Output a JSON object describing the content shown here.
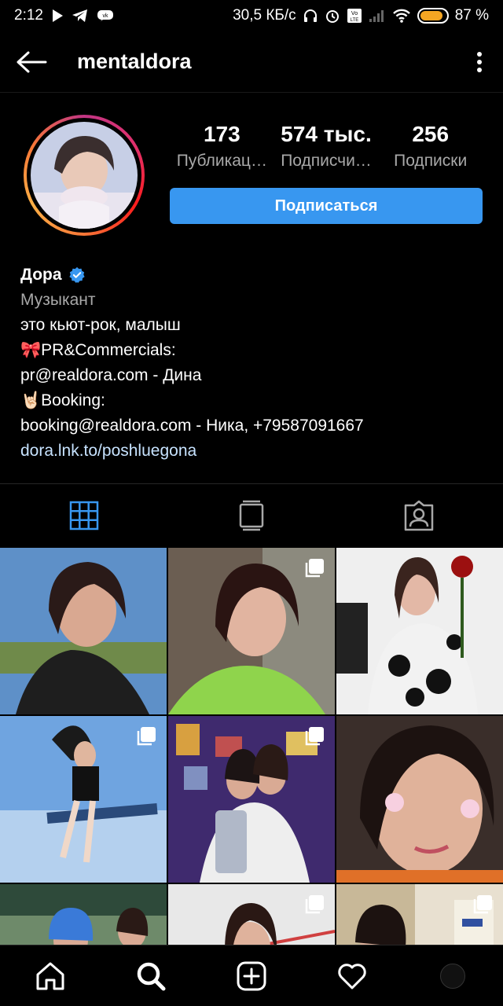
{
  "status_bar": {
    "time": "2:12",
    "network_speed": "30,5 КБ/с",
    "battery_text": "87 %",
    "battery_level": 0.87
  },
  "nav": {
    "username": "mentaldora"
  },
  "profile": {
    "stats": [
      {
        "value": "173",
        "label": "Публикац…"
      },
      {
        "value": "574 тыс.",
        "label": "Подписчи…"
      },
      {
        "value": "256",
        "label": "Подписки"
      }
    ],
    "follow_label": "Подписаться"
  },
  "bio": {
    "name": "Дора",
    "category": "Музыкант",
    "lines": [
      "это кьют-рок, малыш",
      "🎀PR&Commercials:",
      "pr@realdora.com - Дина",
      "🤘🏻Booking:",
      "booking@realdora.com - Ника, +79587091667"
    ],
    "link": "dora.lnk.to/poshluegona"
  },
  "tabs": [
    {
      "icon": "grid-icon",
      "active": true
    },
    {
      "icon": "igtv-icon",
      "active": false
    },
    {
      "icon": "tagged-icon",
      "active": false
    }
  ],
  "colors": {
    "accent": "#3897f0",
    "tab_active": "#3897f0",
    "verified": "#3897f0"
  },
  "grid": {
    "posts": [
      {
        "multi": false
      },
      {
        "multi": true
      },
      {
        "multi": false
      },
      {
        "multi": true
      },
      {
        "multi": true
      },
      {
        "multi": false
      },
      {
        "multi": false
      },
      {
        "multi": true
      },
      {
        "multi": true
      }
    ]
  },
  "bottom_nav": [
    {
      "icon": "home-icon"
    },
    {
      "icon": "search-icon"
    },
    {
      "icon": "new-post-icon"
    },
    {
      "icon": "heart-icon"
    },
    {
      "icon": "profile-avatar"
    }
  ]
}
